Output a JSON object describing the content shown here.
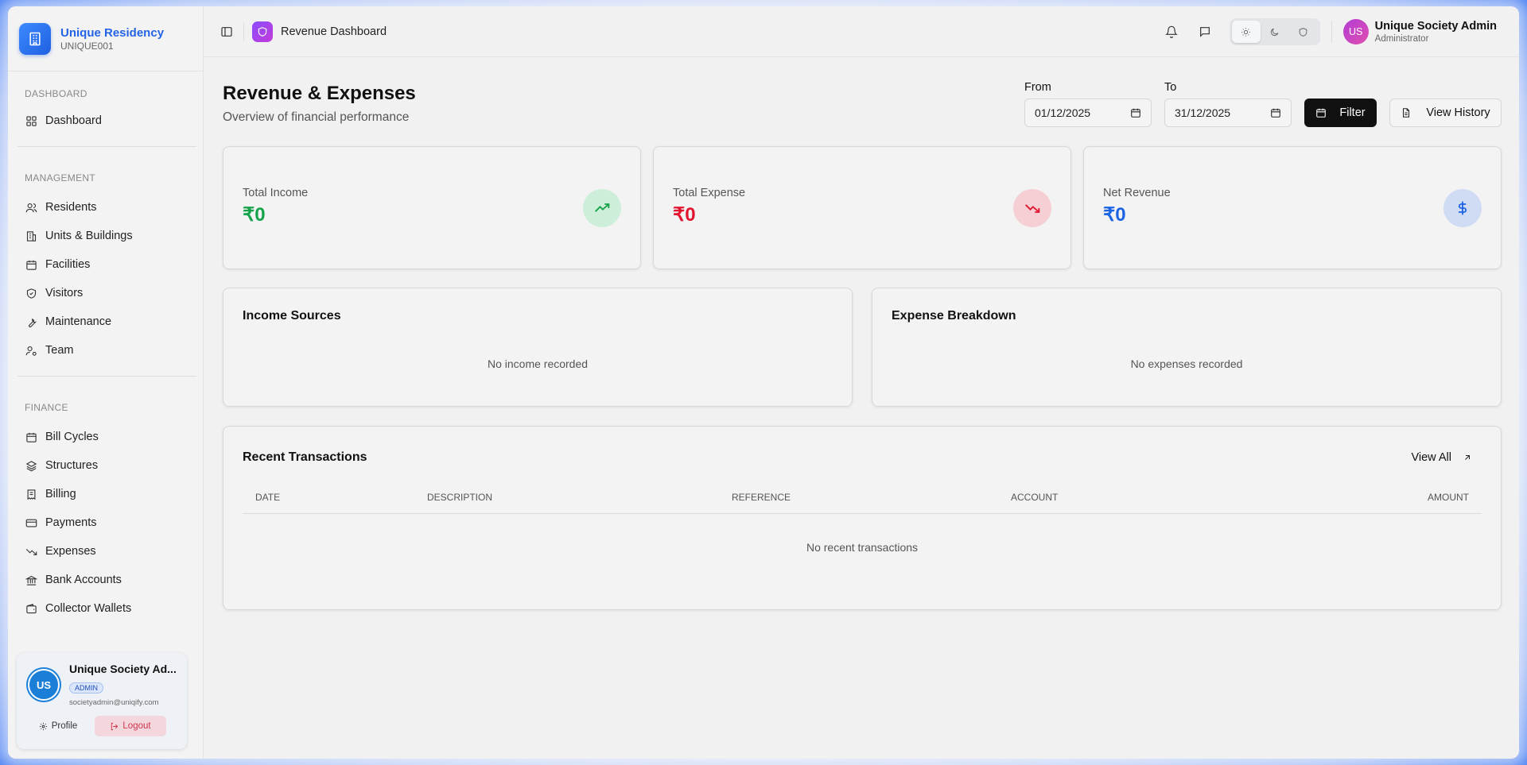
{
  "brand": {
    "name": "Unique Residency",
    "code": "UNIQUE001"
  },
  "sidebar": {
    "sections": [
      {
        "label": "DASHBOARD",
        "items": [
          {
            "label": "Dashboard",
            "icon": "grid-icon"
          }
        ]
      },
      {
        "label": "MANAGEMENT",
        "items": [
          {
            "label": "Residents",
            "icon": "users-icon"
          },
          {
            "label": "Units & Buildings",
            "icon": "building-icon"
          },
          {
            "label": "Facilities",
            "icon": "calendar-icon"
          },
          {
            "label": "Visitors",
            "icon": "shield-icon"
          },
          {
            "label": "Maintenance",
            "icon": "wrench-icon"
          },
          {
            "label": "Team",
            "icon": "user-cog-icon"
          }
        ]
      },
      {
        "label": "FINANCE",
        "items": [
          {
            "label": "Bill Cycles",
            "icon": "calendar-icon"
          },
          {
            "label": "Structures",
            "icon": "layers-icon"
          },
          {
            "label": "Billing",
            "icon": "receipt-icon"
          },
          {
            "label": "Payments",
            "icon": "credit-card-icon"
          },
          {
            "label": "Expenses",
            "icon": "trending-down-icon"
          },
          {
            "label": "Bank Accounts",
            "icon": "bank-icon"
          },
          {
            "label": "Collector Wallets",
            "icon": "wallet-icon"
          }
        ]
      }
    ],
    "user_card": {
      "initials": "US",
      "name": "Unique Society Ad...",
      "badge": "ADMIN",
      "email": "societyadmin@uniqify.com",
      "profile_label": "Profile",
      "logout_label": "Logout"
    }
  },
  "header": {
    "page_title": "Revenue Dashboard",
    "user": {
      "initials": "US",
      "name": "Unique Society Admin",
      "role": "Administrator"
    }
  },
  "main": {
    "title": "Revenue & Expenses",
    "subtitle": "Overview of financial performance",
    "filters": {
      "from_label": "From",
      "from_value": "01/12/2025",
      "to_label": "To",
      "to_value": "31/12/2025",
      "filter_label": "Filter",
      "history_label": "View History"
    },
    "stats": [
      {
        "label": "Total Income",
        "value": "₹0",
        "color": "#15a34a",
        "icon_bg": "#cdeed8"
      },
      {
        "label": "Total Expense",
        "value": "₹0",
        "color": "#e0142e",
        "icon_bg": "#f5cfd4"
      },
      {
        "label": "Net Revenue",
        "value": "₹0",
        "color": "#1d63e5",
        "icon_bg": "#cfdcf3"
      }
    ],
    "income": {
      "title": "Income Sources",
      "empty": "No income recorded"
    },
    "expense": {
      "title": "Expense Breakdown",
      "empty": "No expenses recorded"
    },
    "transactions": {
      "title": "Recent Transactions",
      "view_all": "View All",
      "columns": [
        "DATE",
        "DESCRIPTION",
        "REFERENCE",
        "ACCOUNT",
        "AMOUNT"
      ],
      "empty": "No recent transactions"
    }
  }
}
